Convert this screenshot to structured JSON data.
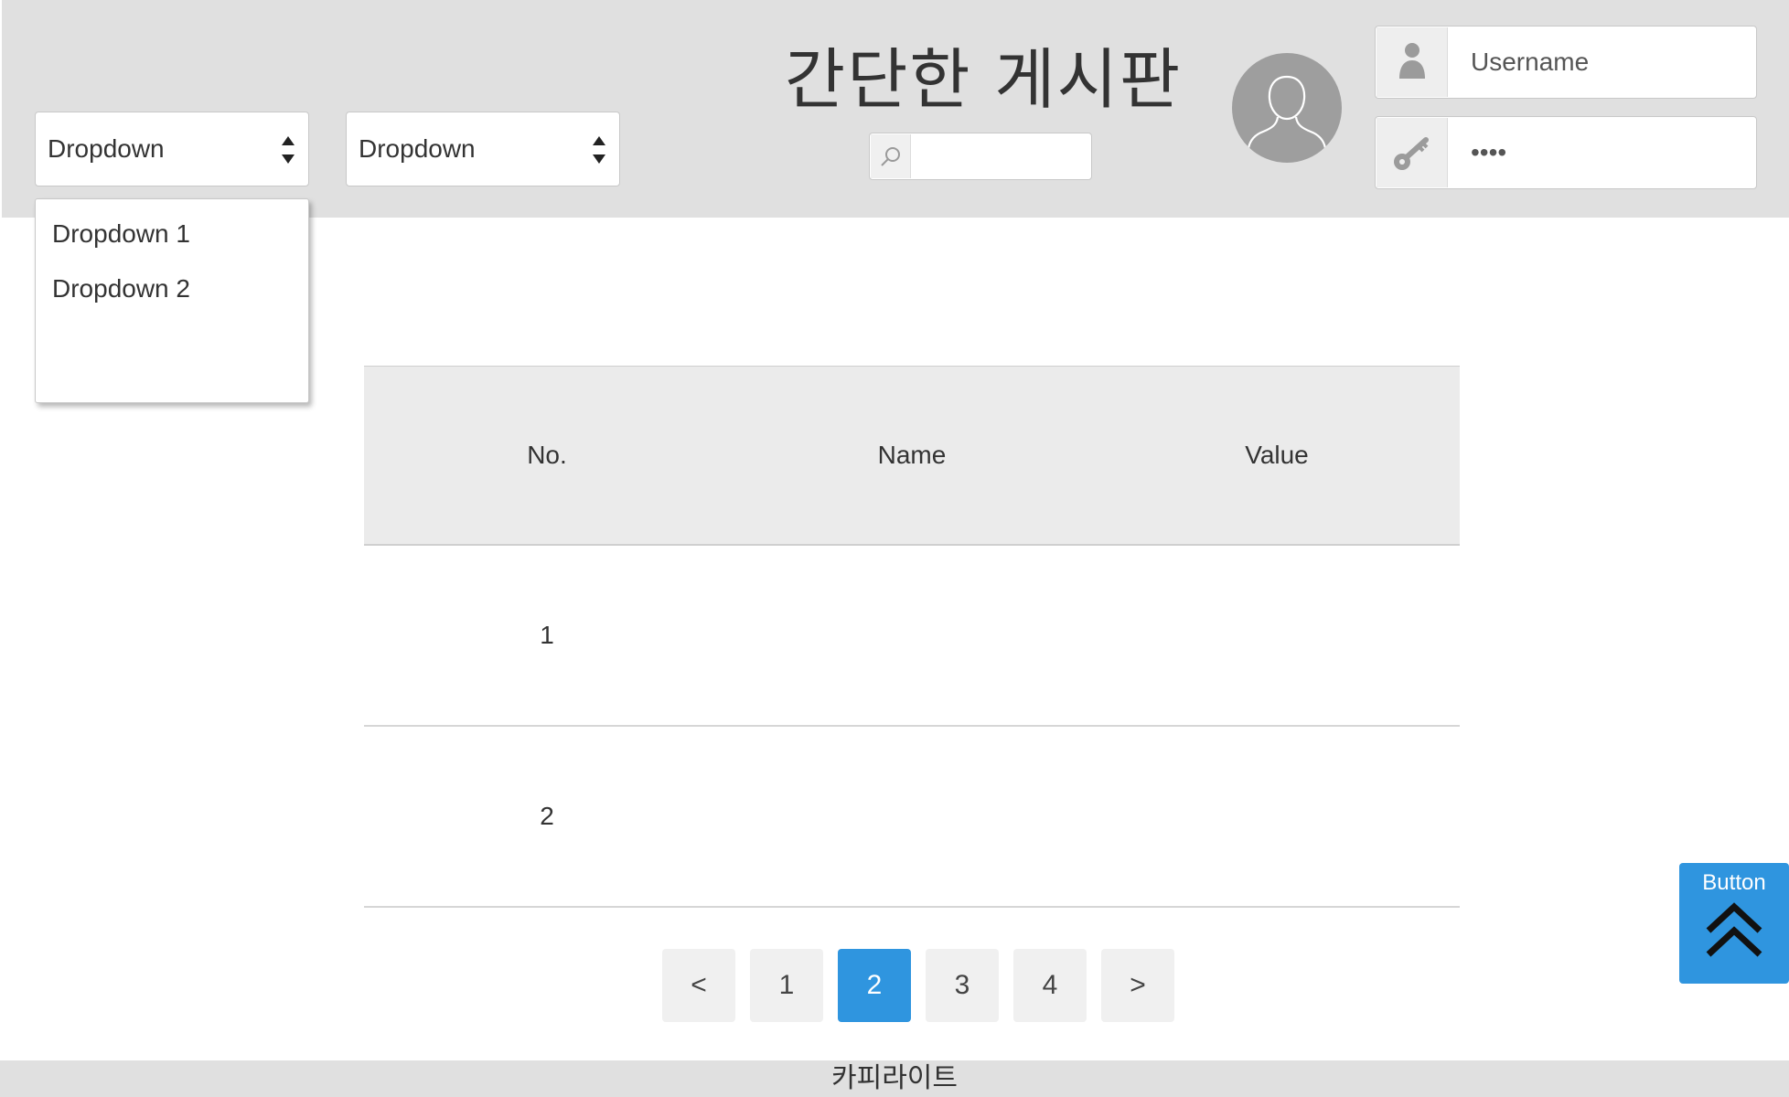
{
  "header": {
    "title": "간단한 게시판",
    "dropdown_1": {
      "value": "Dropdown"
    },
    "dropdown_2": {
      "value": "Dropdown"
    },
    "dropdown_menu": {
      "items": [
        "Dropdown 1",
        "Dropdown 2"
      ]
    },
    "search": {
      "value": "",
      "icon": "search-icon"
    },
    "avatar": {
      "icon": "user-silhouette-icon"
    },
    "username": {
      "value": "Username",
      "icon": "person-icon"
    },
    "password": {
      "value": "••••",
      "icon": "key-icon"
    }
  },
  "table": {
    "columns": [
      "No.",
      "Name",
      "Value"
    ],
    "rows": [
      {
        "no": "1",
        "name": "",
        "value": ""
      },
      {
        "no": "2",
        "name": "",
        "value": ""
      }
    ]
  },
  "pagination": {
    "prev": "<",
    "pages": [
      "1",
      "2",
      "3",
      "4"
    ],
    "active_page": "2",
    "next": ">"
  },
  "fab": {
    "label": "Button",
    "icon": "double-chevron-up-icon"
  },
  "footer": {
    "text": "카피라이트"
  },
  "colors": {
    "header_bg": "#e0e0e0",
    "accent": "#2f95df",
    "table_header_bg": "#ebebeb"
  }
}
